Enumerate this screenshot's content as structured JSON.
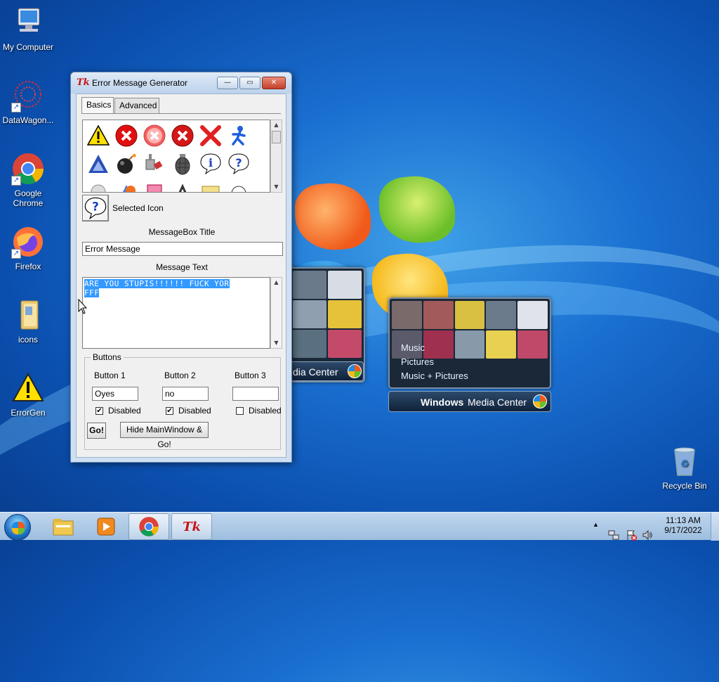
{
  "desktop": {
    "icons": [
      {
        "id": "my-computer",
        "label": "My Computer"
      },
      {
        "id": "datawagon",
        "label": "DataWagon..."
      },
      {
        "id": "google-chrome",
        "label": "Google Chrome"
      },
      {
        "id": "firefox",
        "label": "Firefox"
      },
      {
        "id": "icons-folder",
        "label": "icons"
      },
      {
        "id": "errorgen",
        "label": "ErrorGen"
      },
      {
        "id": "recycle-bin",
        "label": "Recycle Bin"
      }
    ],
    "media_center": {
      "menu": [
        "Music",
        "Pictures",
        "Music + Pictures"
      ],
      "bar_prefix": "Windows",
      "bar_suffix": "Media Center",
      "back_bar_text": "dia Center"
    }
  },
  "window": {
    "logo": "Tk",
    "title": "Error Message Generator",
    "controls": {
      "minimize": "—",
      "maximize": "▭",
      "close": "✕"
    },
    "tabs": [
      {
        "label": "Basics",
        "active": true
      },
      {
        "label": "Advanced",
        "active": false
      }
    ],
    "icons_grid": [
      "warning-icon",
      "error-icon",
      "error-faded-icon",
      "error-icon",
      "red-x-icon",
      "aim-runner-icon",
      "triangle-icon",
      "bomb-icon",
      "plug-icon",
      "grenade-icon",
      "info-icon",
      "question-icon"
    ],
    "selected_icon_glyph": "?",
    "selected_icon_label": "Selected Icon",
    "title_label": "MessageBox Title",
    "title_value": "Error Message",
    "text_label": "Message Text",
    "text_value_line1": "ARE YOU STUPIS!!!!!! FUCK YOR",
    "text_value_line2": "FFF",
    "buttons_group": {
      "title": "Buttons",
      "columns": [
        {
          "label": "Button 1",
          "value": "Oyes",
          "disabled_label": "Disabled",
          "disabled": true
        },
        {
          "label": "Button 2",
          "value": "no",
          "disabled_label": "Disabled",
          "disabled": true
        },
        {
          "label": "Button 3",
          "value": "",
          "disabled_label": "Disabled",
          "disabled": false
        }
      ],
      "go_label": "Go!",
      "hide_go_label": "Hide MainWindow & Go!"
    }
  },
  "taskbar": {
    "time": "11:13 AM",
    "date": "9/17/2022",
    "tk_label": "Tk",
    "tray_chevron": "▲"
  }
}
